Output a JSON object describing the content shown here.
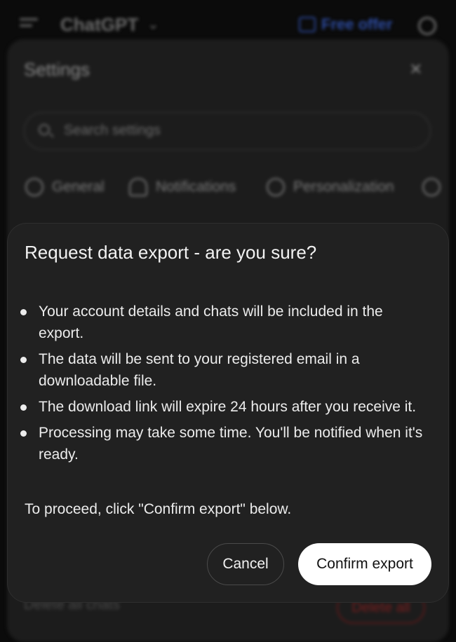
{
  "app": {
    "title": "ChatGPT",
    "offer_label": "Free offer"
  },
  "settings": {
    "title": "Settings",
    "close_symbol": "×",
    "search_placeholder": "Search settings",
    "tabs": [
      {
        "label": "General",
        "icon": "gear-icon"
      },
      {
        "label": "Notifications",
        "icon": "bell-icon"
      },
      {
        "label": "Personalization",
        "icon": "personalization-icon"
      }
    ],
    "delete_all_chats_label": "Delete all chats",
    "delete_all_button": "Delete all"
  },
  "dialog": {
    "title": "Request data export - are you sure?",
    "bullets": [
      "Your account details and chats will be included in the export.",
      "The data will be sent to your registered email in a downloadable file.",
      "The download link will expire 24 hours after you receive it.",
      "Processing may take some time. You'll be notified when it's ready."
    ],
    "proceed_text": "To proceed, click \"Confirm export\" below.",
    "cancel_label": "Cancel",
    "confirm_label": "Confirm export"
  },
  "colors": {
    "dialog_background": "#212121",
    "confirm_button_background": "#ffffff",
    "offer_accent": "#2c4a9e",
    "delete_accent": "#7a1e1e"
  }
}
